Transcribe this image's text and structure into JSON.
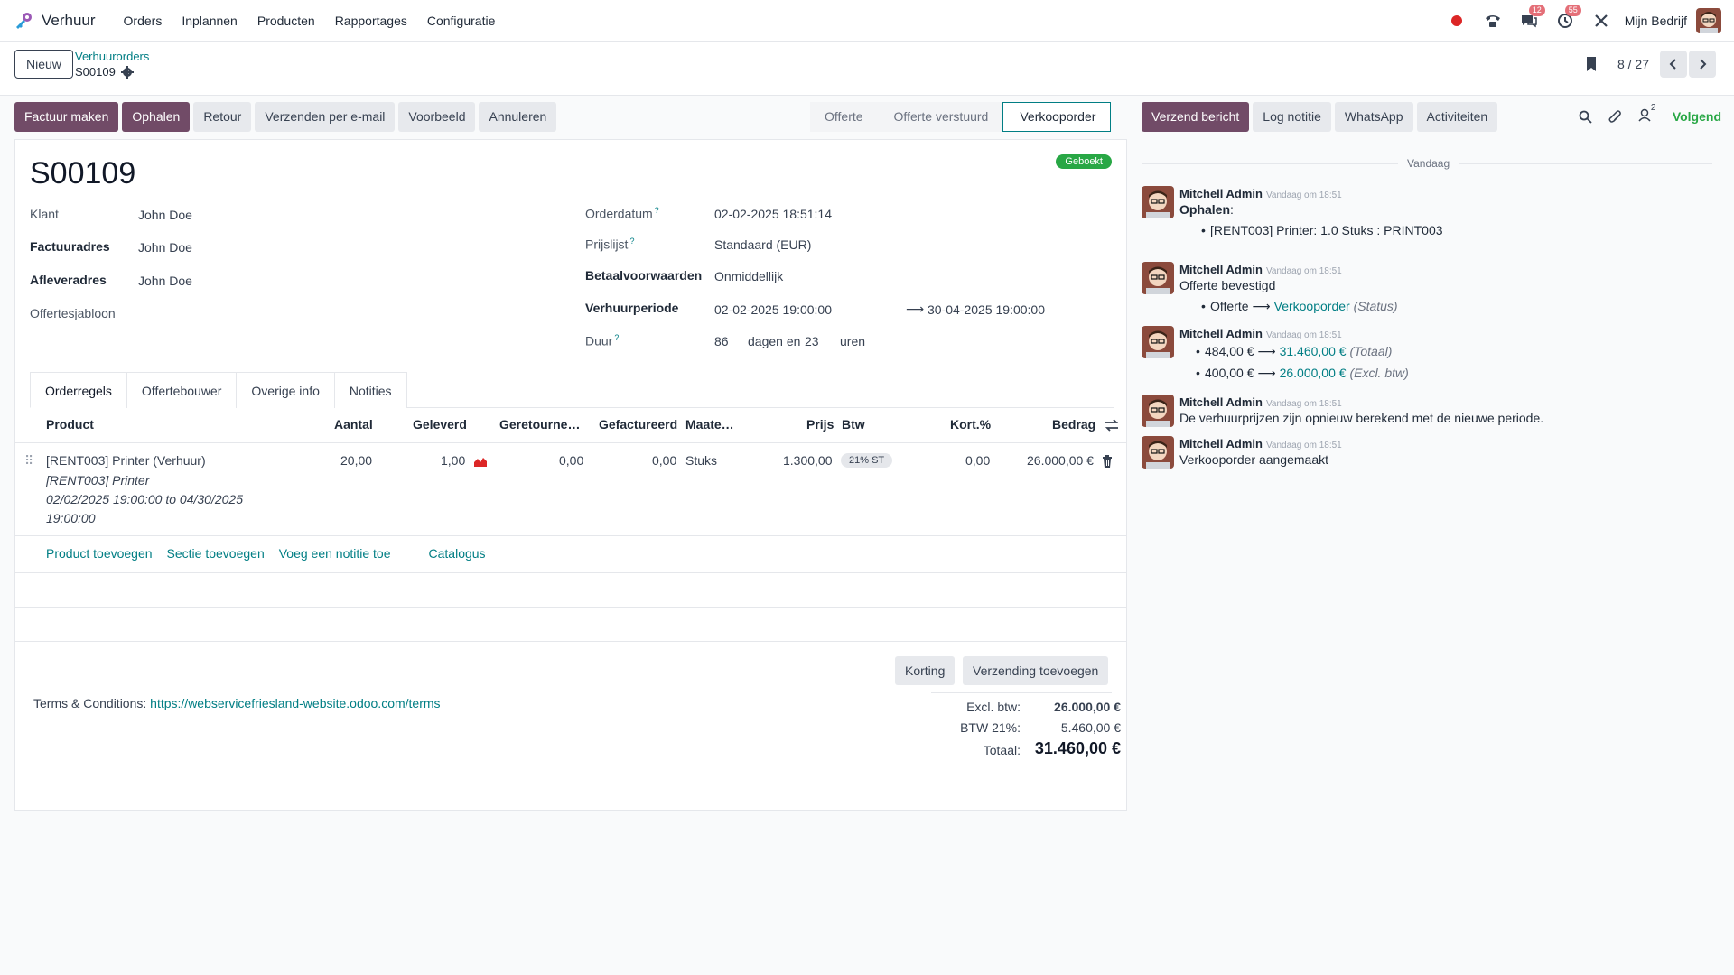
{
  "navbar": {
    "app_name": "Verhuur",
    "menu": [
      "Orders",
      "Inplannen",
      "Producten",
      "Rapportages",
      "Configuratie"
    ],
    "chat_badge": "12",
    "activity_badge": "55",
    "company": "Mijn Bedrijf"
  },
  "control_panel": {
    "new_label": "Nieuw",
    "breadcrumb_parent": "Verhuurorders",
    "breadcrumb_current": "S00109",
    "pager_value": "8 / 27"
  },
  "actions": {
    "invoice": "Factuur maken",
    "pickup": "Ophalen",
    "return": "Retour",
    "send_email": "Verzenden per e-mail",
    "preview": "Voorbeeld",
    "cancel": "Annuleren"
  },
  "statusbar": {
    "stages": [
      "Offerte",
      "Offerte verstuurd",
      "Verkooporder"
    ],
    "active": "Verkooporder"
  },
  "record": {
    "ribbon": "Geboekt",
    "title": "S00109",
    "fields_left": {
      "customer_label": "Klant",
      "customer_value": "John Doe",
      "invoice_address_label": "Factuuradres",
      "invoice_address_value": "John Doe",
      "delivery_address_label": "Afleveradres",
      "delivery_address_value": "John Doe",
      "quote_template_label": "Offertesjabloon"
    },
    "fields_right": {
      "order_date_label": "Orderdatum",
      "order_date_value": "02-02-2025 18:51:14",
      "pricelist_label": "Prijslijst",
      "pricelist_value": "Standaard (EUR)",
      "payment_terms_label": "Betaalvoorwaarden",
      "payment_terms_value": "Onmiddellijk",
      "rental_period_label": "Verhuurperiode",
      "rental_start": "02-02-2025 19:00:00",
      "rental_end": "30-04-2025 19:00:00",
      "duration_label": "Duur",
      "duration_days": "86",
      "days_and": "dagen en",
      "duration_hours": "23",
      "hours_label": "uren"
    }
  },
  "tabs": [
    "Orderregels",
    "Offertebouwer",
    "Overige info",
    "Notities"
  ],
  "table": {
    "headers": {
      "product": "Product",
      "qty": "Aantal",
      "delivered": "Geleverd",
      "returned": "Geretourne…",
      "invoiced": "Gefactureerd",
      "uom": "Maate…",
      "price": "Prijs",
      "tax": "Btw",
      "discount": "Kort.%",
      "amount": "Bedrag"
    },
    "row": {
      "product": "[RENT003] Printer (Verhuur)",
      "desc1": "[RENT003] Printer",
      "desc2": "02/02/2025 19:00:00 to 04/30/2025",
      "desc3": "19:00:00",
      "qty": "20,00",
      "delivered": "1,00",
      "returned": "0,00",
      "invoiced": "0,00",
      "uom": "Stuks",
      "price": "1.300,00",
      "tax": "21% ST",
      "discount": "0,00",
      "amount": "26.000,00 €"
    },
    "add_product": "Product toevoegen",
    "add_section": "Sectie toevoegen",
    "add_note": "Voeg een notitie toe",
    "catalog": "Catalogus"
  },
  "footer": {
    "discount_btn": "Korting",
    "shipping_btn": "Verzending toevoegen",
    "terms_label": "Terms & Conditions:",
    "terms_link": "https://webservicefriesland-website.odoo.com/terms",
    "untaxed_label": "Excl. btw:",
    "untaxed_value": "26.000,00 €",
    "tax_label": "BTW 21%:",
    "tax_value": "5.460,00 €",
    "total_label": "Totaal:",
    "total_value": "31.460,00 €"
  },
  "chatter": {
    "send_message": "Verzend bericht",
    "log_note": "Log notitie",
    "whatsapp": "WhatsApp",
    "activities": "Activiteiten",
    "followers_count": "2",
    "follow": "Volgend",
    "today": "Vandaag",
    "messages": [
      {
        "author": "Mitchell Admin",
        "date": "Vandaag om 18:51",
        "title": "Ophalen",
        "bullet": "[RENT003] Printer: 1.0 Stuks : PRINT003"
      },
      {
        "author": "Mitchell Admin",
        "date": "Vandaag om 18:51",
        "text": "Offerte bevestigd",
        "old": "Offerte",
        "new": "Verkooporder",
        "field": "(Status)"
      },
      {
        "author": "Mitchell Admin",
        "date": "Vandaag om 18:51",
        "old1": "484,00 €",
        "new1": "31.460,00 €",
        "field1": "(Totaal)",
        "old2": "400,00 €",
        "new2": "26.000,00 €",
        "field2": "(Excl. btw)"
      },
      {
        "author": "Mitchell Admin",
        "date": "Vandaag om 18:51",
        "text": "De verhuurprijzen zijn opnieuw berekend met de nieuwe periode."
      },
      {
        "author": "Mitchell Admin",
        "date": "Vandaag om 18:51",
        "text": "Verkooporder aangemaakt"
      }
    ]
  },
  "colors": {
    "primary": "#714b67",
    "link": "#017e84",
    "success": "#28a745",
    "badge": "#e46f78"
  }
}
